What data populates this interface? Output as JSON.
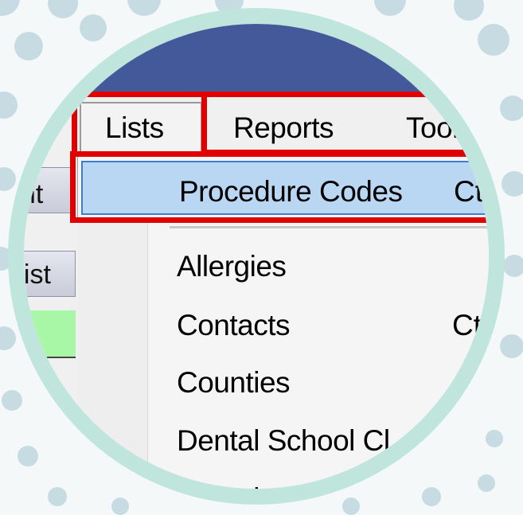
{
  "menubar": {
    "items": [
      {
        "label": "Lists"
      },
      {
        "label": "Reports"
      },
      {
        "label": "Tools"
      }
    ]
  },
  "left_panel": {
    "buttons": [
      {
        "label": "ent"
      },
      {
        "label": "List"
      }
    ],
    "accent_color": "#a7f7a6"
  },
  "dropdown": {
    "highlighted": {
      "label": "Procedure Codes",
      "shortcut": "Ctrl"
    },
    "items": [
      {
        "label": "Allergies",
        "shortcut": ""
      },
      {
        "label": "Contacts",
        "shortcut": "Ctrl"
      },
      {
        "label": "Counties",
        "shortcut": ""
      },
      {
        "label": "Dental School Cl",
        "shortcut": ""
      },
      {
        "label": "Dental Schools",
        "shortcut": ""
      }
    ]
  },
  "colors": {
    "title_bar": "#43599a",
    "highlight_fill": "#b9d7f3",
    "highlight_border": "#3c7fc8",
    "annotation_red": "#e00000",
    "frame_ring": "#bfe5dc"
  }
}
